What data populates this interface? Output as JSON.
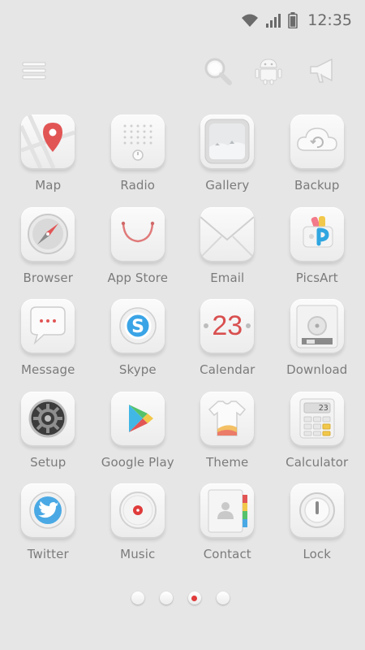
{
  "status": {
    "time": "12:35"
  },
  "apps": [
    {
      "label": "Map",
      "icon": "map-pin-icon"
    },
    {
      "label": "Radio",
      "icon": "radio-icon"
    },
    {
      "label": "Gallery",
      "icon": "gallery-icon"
    },
    {
      "label": "Backup",
      "icon": "cloud-sync-icon"
    },
    {
      "label": "Browser",
      "icon": "compass-icon"
    },
    {
      "label": "App Store",
      "icon": "shopping-bag-icon"
    },
    {
      "label": "Email",
      "icon": "envelope-icon"
    },
    {
      "label": "PicsArt",
      "icon": "picsart-icon"
    },
    {
      "label": "Message",
      "icon": "speech-bubble-icon"
    },
    {
      "label": "Skype",
      "icon": "skype-icon"
    },
    {
      "label": "Calendar",
      "icon": "calendar-icon",
      "day": "23"
    },
    {
      "label": "Download",
      "icon": "download-disc-icon"
    },
    {
      "label": "Setup",
      "icon": "gear-icon"
    },
    {
      "label": "Google Play",
      "icon": "play-store-icon"
    },
    {
      "label": "Theme",
      "icon": "tshirt-icon"
    },
    {
      "label": "Calculator",
      "icon": "calculator-icon",
      "display": "23"
    },
    {
      "label": "Twitter",
      "icon": "twitter-bird-icon"
    },
    {
      "label": "Music",
      "icon": "music-disc-icon"
    },
    {
      "label": "Contact",
      "icon": "contact-book-icon"
    },
    {
      "label": "Lock",
      "icon": "lock-icon"
    }
  ],
  "pager": {
    "pages": 4,
    "active_index": 2
  },
  "colors": {
    "background": "#e6e6e6",
    "accent": "#e03b3b",
    "label": "#7b7b7b"
  }
}
